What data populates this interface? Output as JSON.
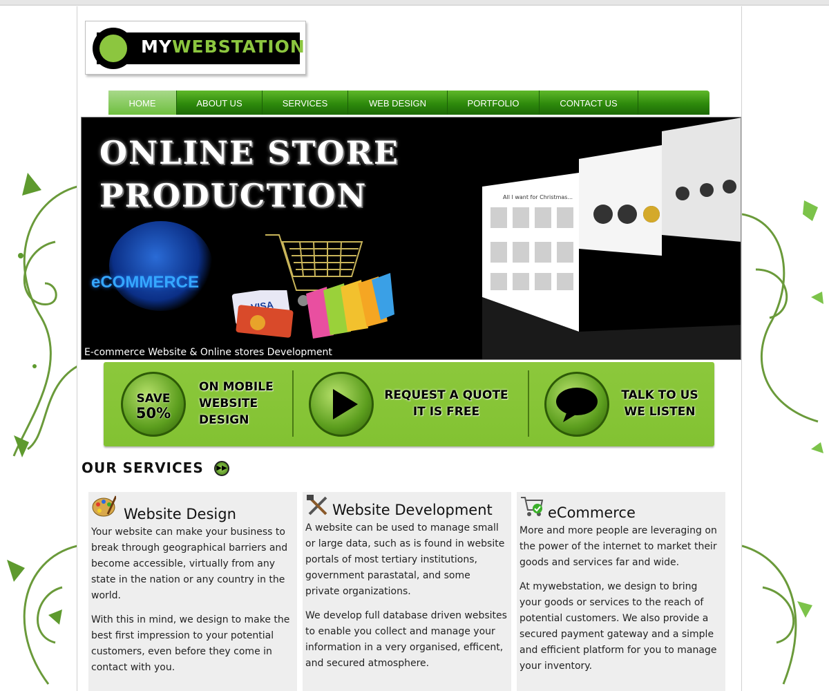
{
  "logo": {
    "my": "MY",
    "webstation": "WEBSTATION"
  },
  "nav": {
    "items": [
      {
        "label": "HOME",
        "active": true
      },
      {
        "label": "ABOUT US",
        "active": false
      },
      {
        "label": "SERVICES",
        "active": false
      },
      {
        "label": "WEB DESIGN",
        "active": false
      },
      {
        "label": "PORTFOLIO",
        "active": false
      },
      {
        "label": "CONTACT US",
        "active": false
      }
    ]
  },
  "banner": {
    "title_line1": "ONLINE STORE",
    "title_line2": "PRODUCTION",
    "ecommerce": "eCOMMERCE",
    "screen_heading": "All I want for Christmas...",
    "caption": "E-commerce Website & Online stores Development"
  },
  "promo": {
    "save": "SAVE",
    "save_pct": "50%",
    "mobile_line1": "ON MOBILE",
    "mobile_line2": "WEBSITE",
    "mobile_line3": "DESIGN",
    "quote_line1": "REQUEST A QUOTE",
    "quote_line2": "IT IS FREE",
    "talk_line1": "TALK TO US",
    "talk_line2": "WE LISTEN"
  },
  "services": {
    "heading": "OUR SERVICES",
    "columns": [
      {
        "title": "Website Design",
        "icon": "palette-icon",
        "paragraphs": [
          "Your website can make your business to break through geographical barriers and become accessible, virtually from any state in the nation or any country in the world.",
          "With this in mind, we design to make the best first impression to your potential customers, even before they come in contact with you."
        ]
      },
      {
        "title": "Website Development",
        "icon": "tools-icon",
        "paragraphs": [
          "A website can be used to manage small or large data, such as is found in website portals of most tertiary institutions, government parastatal, and some private organizations.",
          "We develop full database driven websites to enable you collect and manage your information in a very organised, efficent, and secured atmosphere."
        ]
      },
      {
        "title": "eCommerce",
        "icon": "shopping-cart-icon",
        "paragraphs": [
          "More and more people are leveraging on the power of the internet to market their goods and services far and wide.",
          "At mywebstation, we design to bring your goods or services to the reach of potential customers. We also provide a secured payment gateway and a simple and efficient platform for you to manage your inventory."
        ]
      }
    ]
  },
  "colors": {
    "brand_green": "#8cc63f",
    "nav_green": "#2e8a0c",
    "panel_gray": "#eeeeee"
  }
}
